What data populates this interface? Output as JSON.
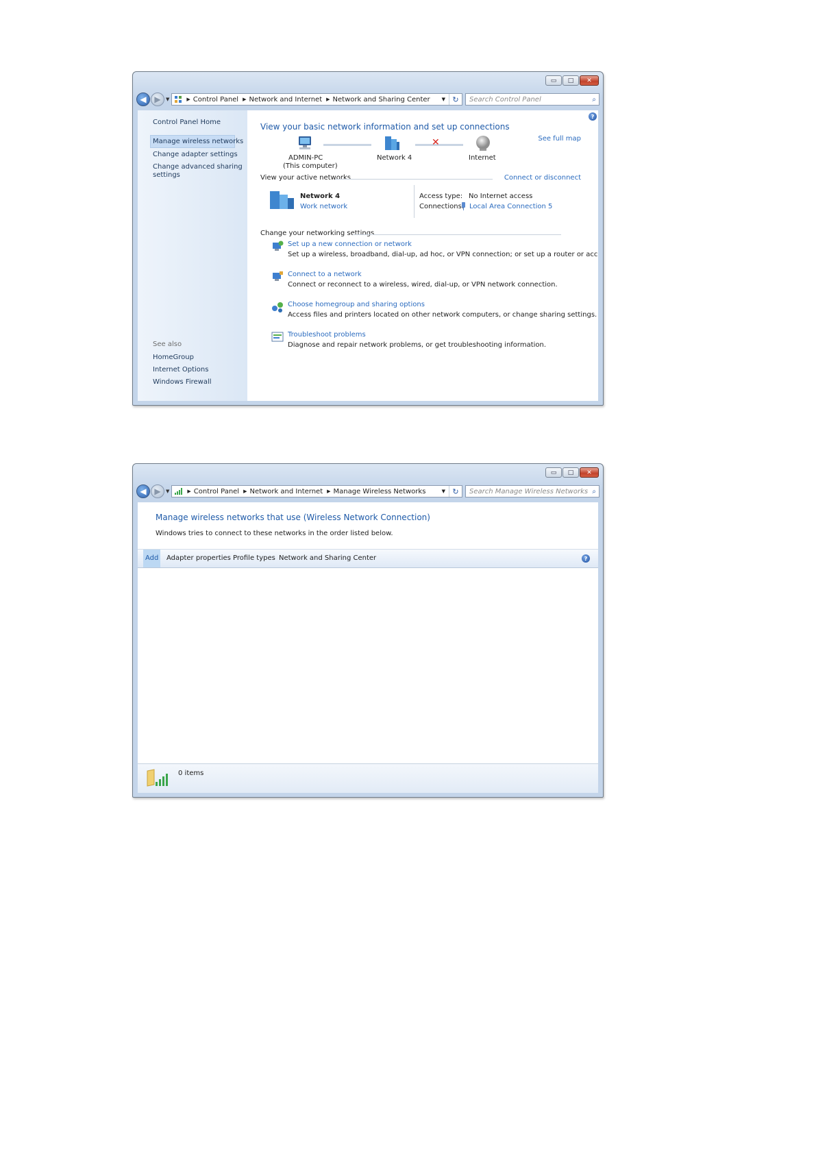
{
  "window_controls": {
    "minimize": "▭",
    "maximize": "□",
    "close": "✕"
  },
  "nav": {
    "back": "◀",
    "forward": "▶",
    "history": "▼",
    "refresh": "↻",
    "search_icon": "⌕"
  },
  "window1": {
    "address": {
      "crumbs": [
        "Control Panel",
        "Network and Internet",
        "Network and Sharing Center"
      ]
    },
    "search_placeholder": "Search Control Panel",
    "sidebar": {
      "home": "Control Panel Home",
      "items": [
        "Manage wireless networks",
        "Change adapter settings",
        "Change advanced sharing",
        "settings"
      ],
      "see_also": "See also",
      "see_also_items": [
        "HomeGroup",
        "Internet Options",
        "Windows Firewall"
      ]
    },
    "main": {
      "title": "View your basic network information and set up connections",
      "see_full_map": "See full map",
      "map": {
        "computer": "ADMIN-PC",
        "computer_sub": "(This computer)",
        "network": "Network  4",
        "internet": "Internet"
      },
      "active_networks_label": "View your active networks",
      "connect_disconnect": "Connect or disconnect",
      "active": {
        "name": "Network  4",
        "type": "Work network",
        "access_label": "Access type:",
        "access_value": "No Internet access",
        "connections_label": "Connections:",
        "connections_value": "Local Area Connection 5"
      },
      "change_settings_label": "Change your networking settings",
      "tasks": [
        {
          "link": "Set up a new connection or network",
          "desc": "Set up a wireless, broadband, dial-up, ad hoc, or VPN connection; or set up a router or access point."
        },
        {
          "link": "Connect to a network",
          "desc": "Connect or reconnect to a wireless, wired, dial-up, or VPN network connection."
        },
        {
          "link": "Choose homegroup and sharing options",
          "desc": "Access files and printers located on other network computers, or change sharing settings."
        },
        {
          "link": "Troubleshoot problems",
          "desc": "Diagnose and repair network problems, or get troubleshooting information."
        }
      ]
    }
  },
  "window2": {
    "address": {
      "crumbs": [
        "Control Panel",
        "Network and Internet",
        "Manage Wireless Networks"
      ]
    },
    "search_placeholder": "Search Manage Wireless Networks",
    "title": "Manage wireless networks that use (Wireless Network Connection)",
    "subtitle": "Windows tries to connect to these networks in the order listed below.",
    "toolbar": [
      "Add",
      "Adapter properties",
      "Profile types",
      "Network and Sharing Center"
    ],
    "status": "0  items"
  },
  "colors": {
    "link": "#2a6bbf",
    "title": "#1e5aa8",
    "sidebar": "#dbe7f5",
    "close_button": "#c2422b"
  }
}
